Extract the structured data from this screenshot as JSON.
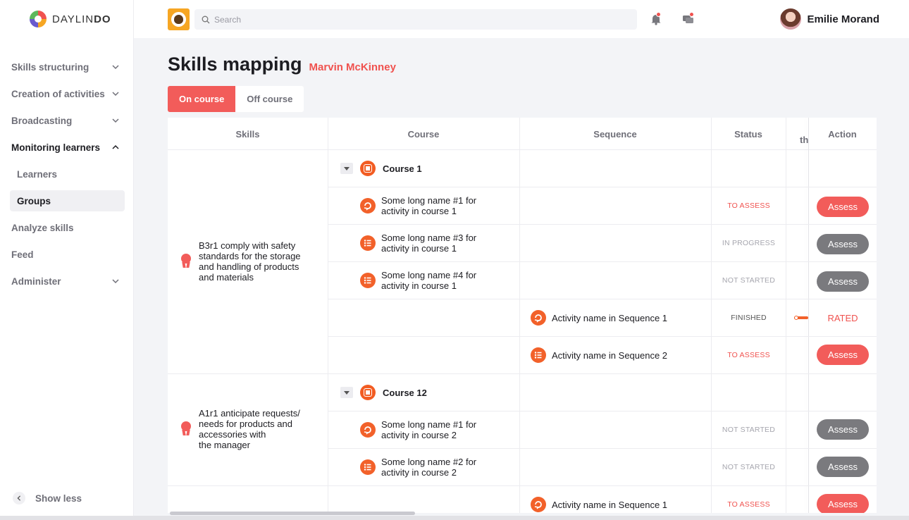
{
  "brand": {
    "logo_text_light": "DAYLIN",
    "logo_text_bold": "DO"
  },
  "sidebar": {
    "items": [
      {
        "label": "Skills structuring",
        "chevron": "down"
      },
      {
        "label": "Creation of activities",
        "chevron": "down"
      },
      {
        "label": "Broadcasting",
        "chevron": "down"
      },
      {
        "label": "Monitoring learners",
        "chevron": "up"
      }
    ],
    "sub_items": [
      {
        "label": "Learners"
      },
      {
        "label": "Groups"
      }
    ],
    "items_after": [
      {
        "label": "Analyze skills"
      },
      {
        "label": "Feed"
      },
      {
        "label": "Administer",
        "chevron": "down"
      }
    ],
    "show_less": "Show less"
  },
  "topbar": {
    "search_placeholder": "Search",
    "user_name": "Emilie Morand"
  },
  "main": {
    "title": "Skills mapping",
    "learner": "Marvin McKinney",
    "tabs": [
      {
        "label": "On course"
      },
      {
        "label": "Off course"
      }
    ],
    "columns": {
      "skills": "Skills",
      "course": "Course",
      "sequence": "Sequence",
      "status": "Status",
      "hidden_fragment": "th",
      "action": "Action"
    },
    "groups": [
      {
        "skill": [
          "B3r1 comply with safety",
          "standards for the storage",
          "and handling of products",
          "and materials"
        ],
        "course": "Course 1",
        "rows": [
          {
            "activity": [
              "Some long name #1 for",
              "activity in course 1"
            ],
            "status": "TO ASSESS",
            "action": "Assess"
          },
          {
            "activity": [
              "Some long name #3 for",
              "activity in course 1"
            ],
            "status": "IN PROGRESS",
            "action": "Assess"
          },
          {
            "activity": [
              "Some long name #4 for",
              "activity in course 1"
            ],
            "status": "NOT STARTED",
            "action": "Assess"
          },
          {
            "sequence": "Activity name in Sequence 1",
            "status": "FINISHED",
            "action": "RATED"
          },
          {
            "sequence": "Activity name in Sequence 2",
            "status": "TO ASSESS",
            "action": "Assess"
          }
        ]
      },
      {
        "skill": [
          "A1r1 anticipate requests/",
          "needs for products and",
          "accessories with",
          "the manager"
        ],
        "course": "Course 12",
        "rows": [
          {
            "activity": [
              "Some long name #1 for",
              "activity in course 2"
            ],
            "status": "NOT STARTED",
            "action": "Assess"
          },
          {
            "activity": [
              "Some long name #2 for",
              "activity in course 2"
            ],
            "status": "NOT STARTED",
            "action": "Assess"
          },
          {
            "sequence": "Activity name in Sequence 1",
            "status": "TO ASSESS",
            "action": "Assess"
          }
        ]
      }
    ]
  },
  "colors": {
    "accent": "#f25c5a",
    "activity_orange": "#f2612a",
    "grey_button": "#7a7a7e"
  }
}
